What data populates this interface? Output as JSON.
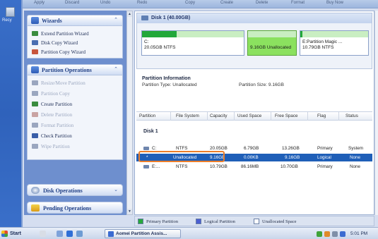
{
  "desktop": {
    "recycle_label": "Recy"
  },
  "toolbar": {
    "items": [
      "Apply",
      "Discard",
      "Undo",
      "Redo",
      "Copy",
      "Create",
      "Delete",
      "Format",
      "Buy Now"
    ]
  },
  "wizards": {
    "title": "Wizards",
    "items": [
      "Extend Partition Wizard",
      "Disk Copy Wizard",
      "Partition Copy Wizard"
    ]
  },
  "operations": {
    "title": "Partition Operations",
    "items": [
      {
        "label": "Resize/Move Partition",
        "enabled": false
      },
      {
        "label": "Partition Copy",
        "enabled": false
      },
      {
        "label": "Create Partition",
        "enabled": true
      },
      {
        "label": "Delete Partition",
        "enabled": false
      },
      {
        "label": "Format Partition",
        "enabled": false
      },
      {
        "label": "Check Partition",
        "enabled": true
      },
      {
        "label": "Wipe Partition",
        "enabled": false
      }
    ]
  },
  "disk_ops": {
    "title": "Disk Operations"
  },
  "pending_ops": {
    "title": "Pending Operations"
  },
  "disk_panel": {
    "title": "Disk 1 (40.00GB)",
    "partitions": [
      {
        "line1": "C:",
        "line2": "20.05GB NTFS",
        "used_fraction": 0.34
      },
      {
        "line1": "",
        "line2": "9.16GB Unallocated",
        "used_fraction": 0
      },
      {
        "line1": "E:Partition Magic ...",
        "line2": "10.79GB NTFS",
        "used_fraction": 0.01
      }
    ]
  },
  "partition_info": {
    "title": "Partition Information",
    "type_text": "Partition Type: Unallocated",
    "size_text": "Partition Size: 9.16GB"
  },
  "table": {
    "columns": [
      "Partition",
      "File System",
      "Capacity",
      "Used Space",
      "Free Space",
      "Flag",
      "Status"
    ],
    "disk_label": "Disk 1",
    "rows": [
      [
        "C:",
        "NTFS",
        "20.05GB",
        "6.79GB",
        "13.26GB",
        "Primary",
        "System"
      ],
      [
        "*",
        "Unallocated",
        "9.16GB",
        "0.00KB",
        "9.16GB",
        "Logical",
        "None"
      ],
      [
        "E:...",
        "NTFS",
        "10.79GB",
        "86.16MB",
        "10.70GB",
        "Primary",
        "None"
      ]
    ]
  },
  "legend": {
    "items": [
      {
        "label": "Primary Partition",
        "color": "#27a83c"
      },
      {
        "label": "Logical Partition",
        "color": "#4b5fd1"
      },
      {
        "label": "Unallocated Space",
        "color": "#ffffff"
      }
    ]
  },
  "taskbar": {
    "start_label": "Start",
    "task_label": "Aomei Partition Assis...",
    "clock": "5:01 PM"
  },
  "colors": {
    "accent": "#1f5fb8",
    "highlight": "#ec7e2a",
    "selected_partition": "#8be15f"
  }
}
